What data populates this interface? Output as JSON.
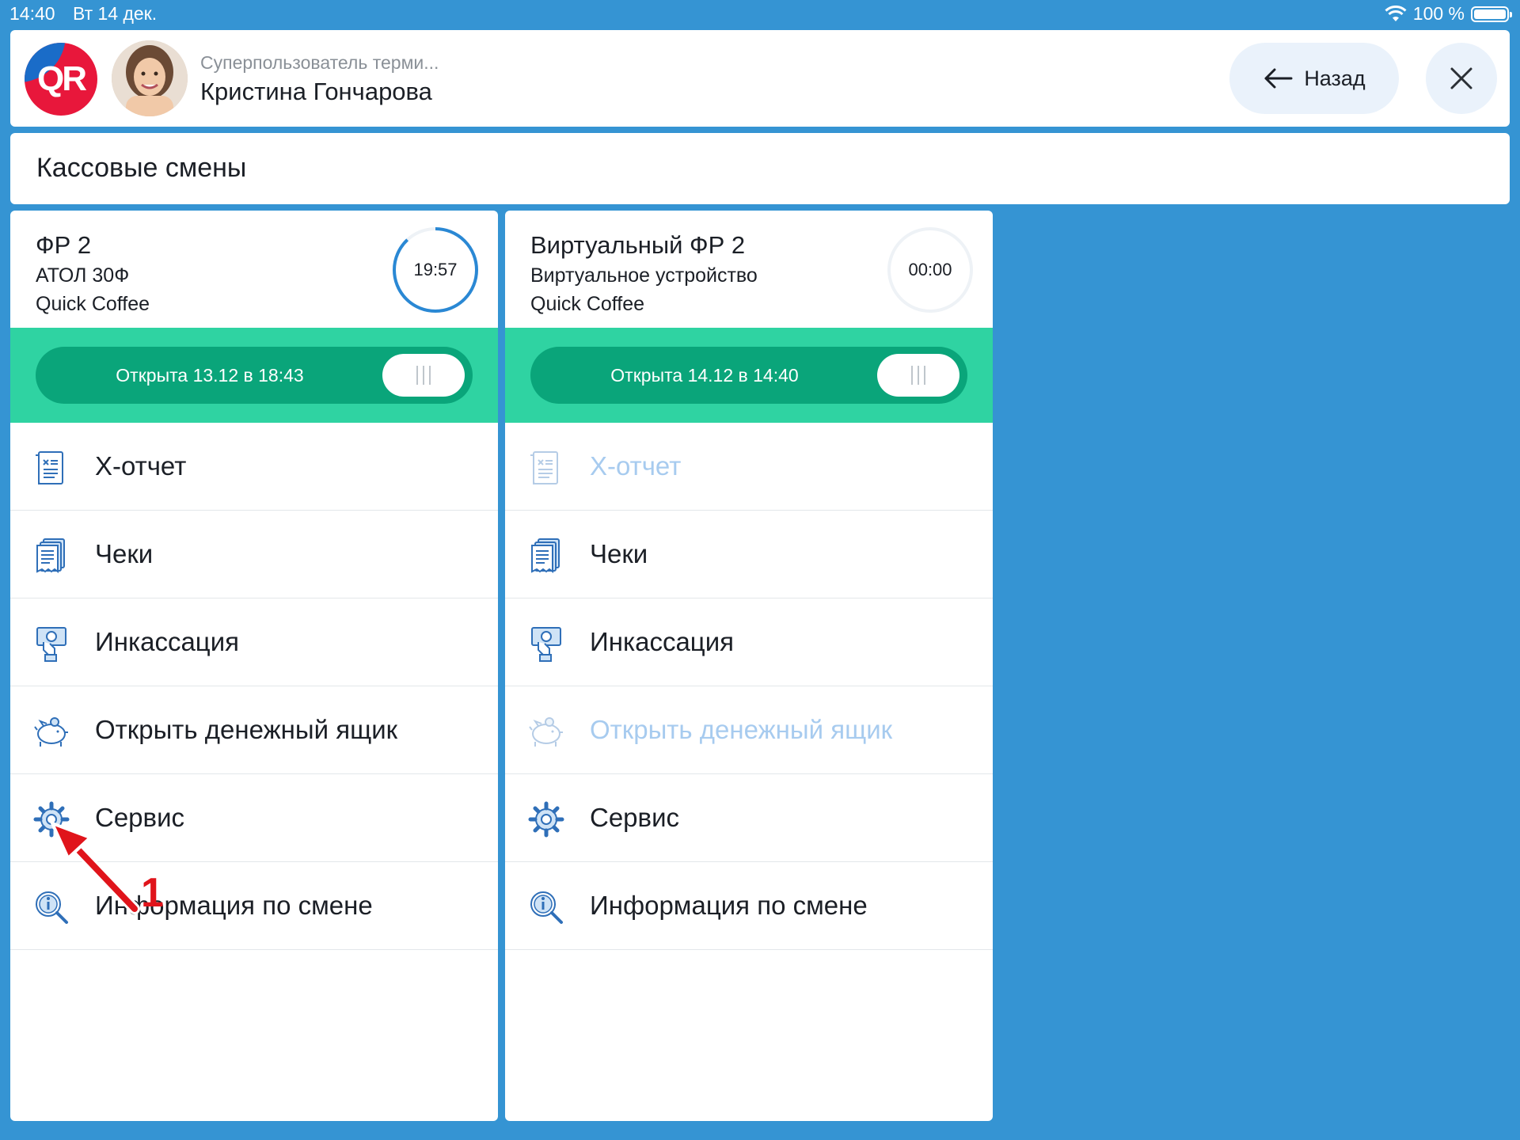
{
  "status_bar": {
    "time": "14:40",
    "date": "Вт 14 дек.",
    "battery": "100 %"
  },
  "header": {
    "logo_text": "QR",
    "user_role": "Суперпользователь терми...",
    "user_name": "Кристина Гончарова",
    "back_label": "Назад"
  },
  "page_title": "Кассовые смены",
  "colors": {
    "background": "#3594d3",
    "shift_band": "#2fd3a2",
    "shift_pill": "#0aa57a",
    "icon_blue": "#2f6fb8",
    "disabled_text": "#a7cbef",
    "annotation_red": "#e0141b"
  },
  "cards": [
    {
      "name": "ФР 2",
      "model": "АТОЛ 30Ф",
      "shop": "Quick Coffee",
      "timer": "19:57",
      "timer_progress": 0.88,
      "shift_status": "Открыта 13.12 в 18:43",
      "menu": [
        {
          "label": "Х-отчет",
          "icon": "report-icon",
          "disabled": false
        },
        {
          "label": "Чеки",
          "icon": "receipts-icon",
          "disabled": false
        },
        {
          "label": "Инкассация",
          "icon": "cash-collection-icon",
          "disabled": false
        },
        {
          "label": "Открыть денежный ящик",
          "icon": "piggy-bank-icon",
          "disabled": false
        },
        {
          "label": "Сервис",
          "icon": "gear-icon",
          "disabled": false
        },
        {
          "label": "Информация по смене",
          "icon": "info-search-icon",
          "disabled": false
        }
      ]
    },
    {
      "name": "Виртуальный ФР 2",
      "model": "Виртуальное устройство",
      "shop": "Quick Coffee",
      "timer": "00:00",
      "timer_progress": 0,
      "shift_status": "Открыта 14.12 в 14:40",
      "menu": [
        {
          "label": "Х-отчет",
          "icon": "report-icon",
          "disabled": true
        },
        {
          "label": "Чеки",
          "icon": "receipts-icon",
          "disabled": false
        },
        {
          "label": "Инкассация",
          "icon": "cash-collection-icon",
          "disabled": false
        },
        {
          "label": "Открыть денежный ящик",
          "icon": "piggy-bank-icon",
          "disabled": true
        },
        {
          "label": "Сервис",
          "icon": "gear-icon",
          "disabled": false
        },
        {
          "label": "Информация по смене",
          "icon": "info-search-icon",
          "disabled": false
        }
      ]
    }
  ],
  "annotation": {
    "number": "1"
  }
}
